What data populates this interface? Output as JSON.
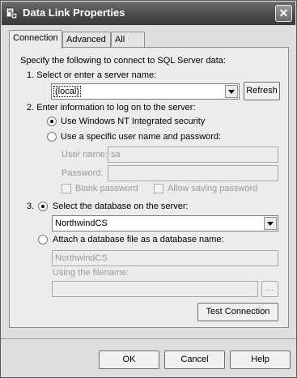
{
  "window": {
    "title": "Data Link Properties",
    "close_glyph": "✕"
  },
  "tabs": [
    {
      "label": "Connection",
      "active": true
    },
    {
      "label": "Advanced",
      "active": false
    },
    {
      "label": "All",
      "active": false
    }
  ],
  "connection": {
    "intro": "Specify the following to connect to SQL Server data:",
    "step1_label": "1. Select or enter a server name:",
    "server_value": "(local)",
    "refresh_label": "Refresh",
    "step2_label": "2. Enter information to log on to the server:",
    "nt_security_label": "Use Windows NT Integrated security",
    "nt_security_selected": true,
    "specific_user_label": "Use a specific user name and password:",
    "specific_user_selected": false,
    "username_label": "User name:",
    "username_value": "sa",
    "password_label": "Password:",
    "password_value": "",
    "blank_password_label": "Blank password",
    "allow_saving_label": "Allow saving password",
    "step3_prefix": "3.",
    "select_db_label": "Select the database on the server:",
    "select_db_selected": true,
    "database_value": "NorthwindCS",
    "attach_db_label": "Attach a database file as a database name:",
    "attach_db_selected": false,
    "attach_db_value": "NorthwindCS",
    "using_filename_label": "Using the filename:",
    "filename_value": "",
    "browse_label": "...",
    "test_connection_label": "Test Connection"
  },
  "footer": {
    "ok_label": "OK",
    "cancel_label": "Cancel",
    "help_label": "Help"
  },
  "colors": {
    "titlebar": "#4a4a4a",
    "dialog_bg": "#dedede",
    "panel_bg": "#ececec"
  }
}
